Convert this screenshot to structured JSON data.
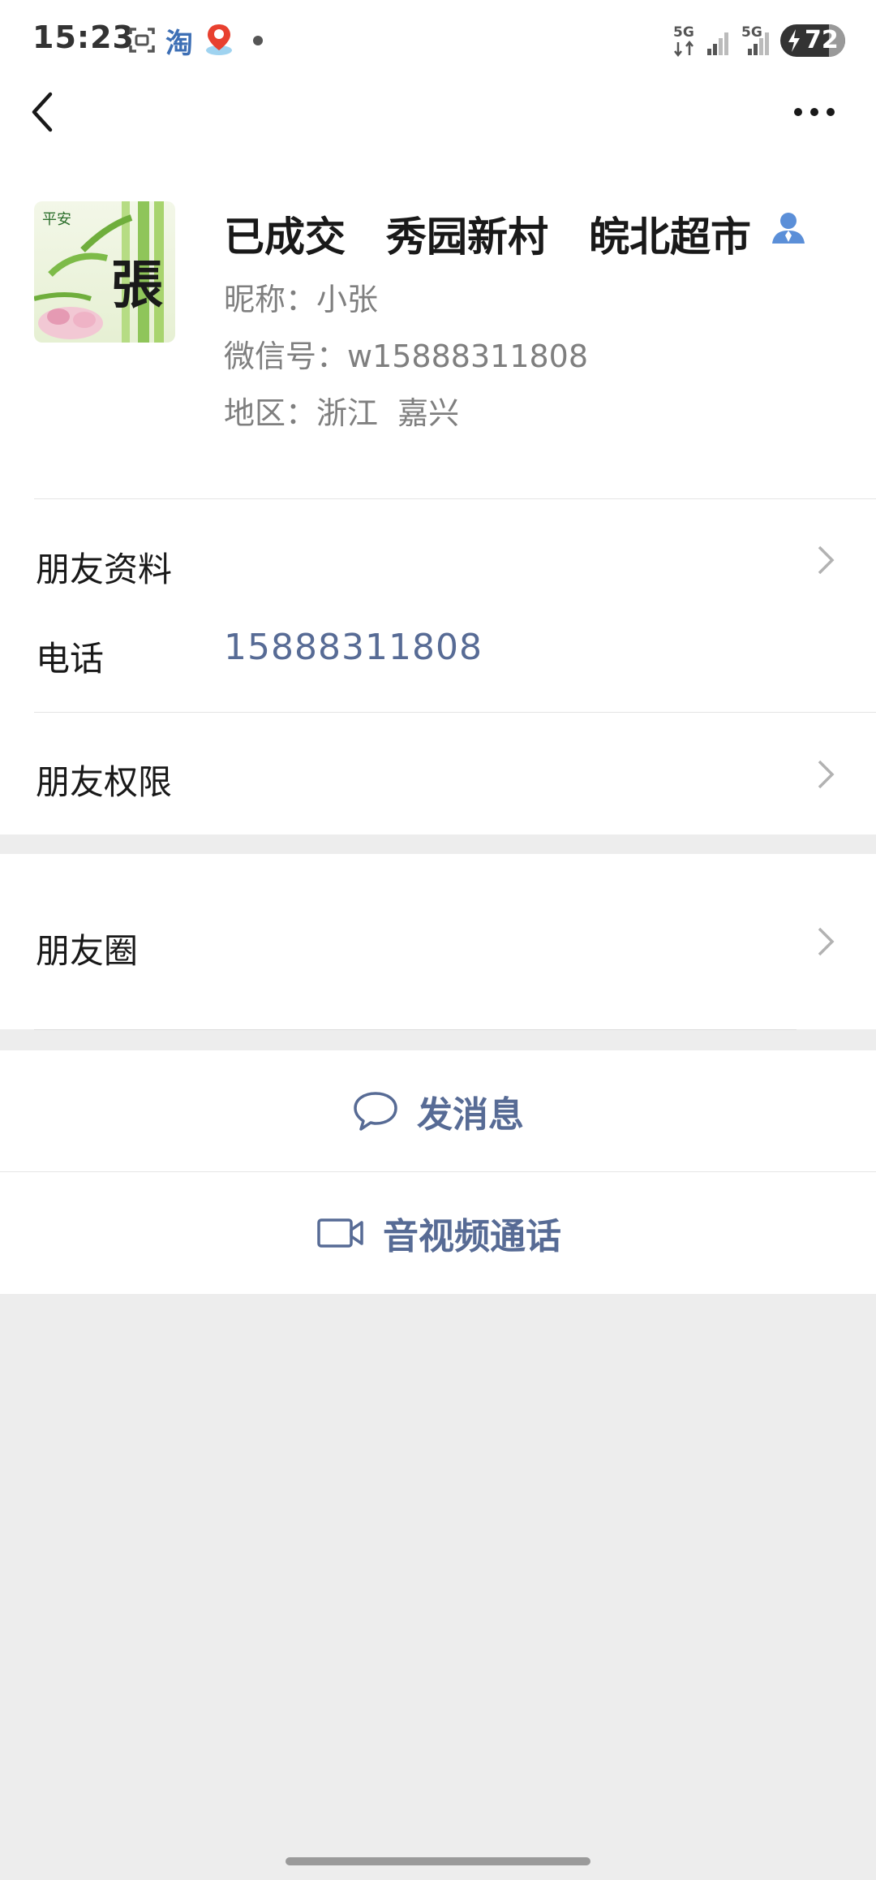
{
  "status_bar": {
    "time": "15:23",
    "taobao_label": "淘",
    "network_1": "5G",
    "network_2": "5G",
    "battery": "72",
    "icons": [
      "screenshot-icon",
      "taobao-icon",
      "baidu-map-icon",
      "notification-dot",
      "signal-icon",
      "signal-icon",
      "battery-charging-icon"
    ]
  },
  "nav": {
    "back_icon": "chevron-left-icon",
    "more_icon": "more-dots-icon"
  },
  "profile": {
    "remark_name": "已成交　秀园新村　皖北超市",
    "avatar_text": "張",
    "nickname": "昵称：小张",
    "wechat_id": "微信号：w15888311808",
    "region": "地区：浙江  嘉兴"
  },
  "rows": {
    "friend_info": "朋友资料",
    "phone_label": "电话",
    "phone_value": "15888311808",
    "permissions": "朋友权限",
    "moments": "朋友圈"
  },
  "actions": {
    "send_message": "发消息",
    "av_call": "音视频通话"
  },
  "colors": {
    "link_blue": "#576b95",
    "background": "#ededed"
  }
}
